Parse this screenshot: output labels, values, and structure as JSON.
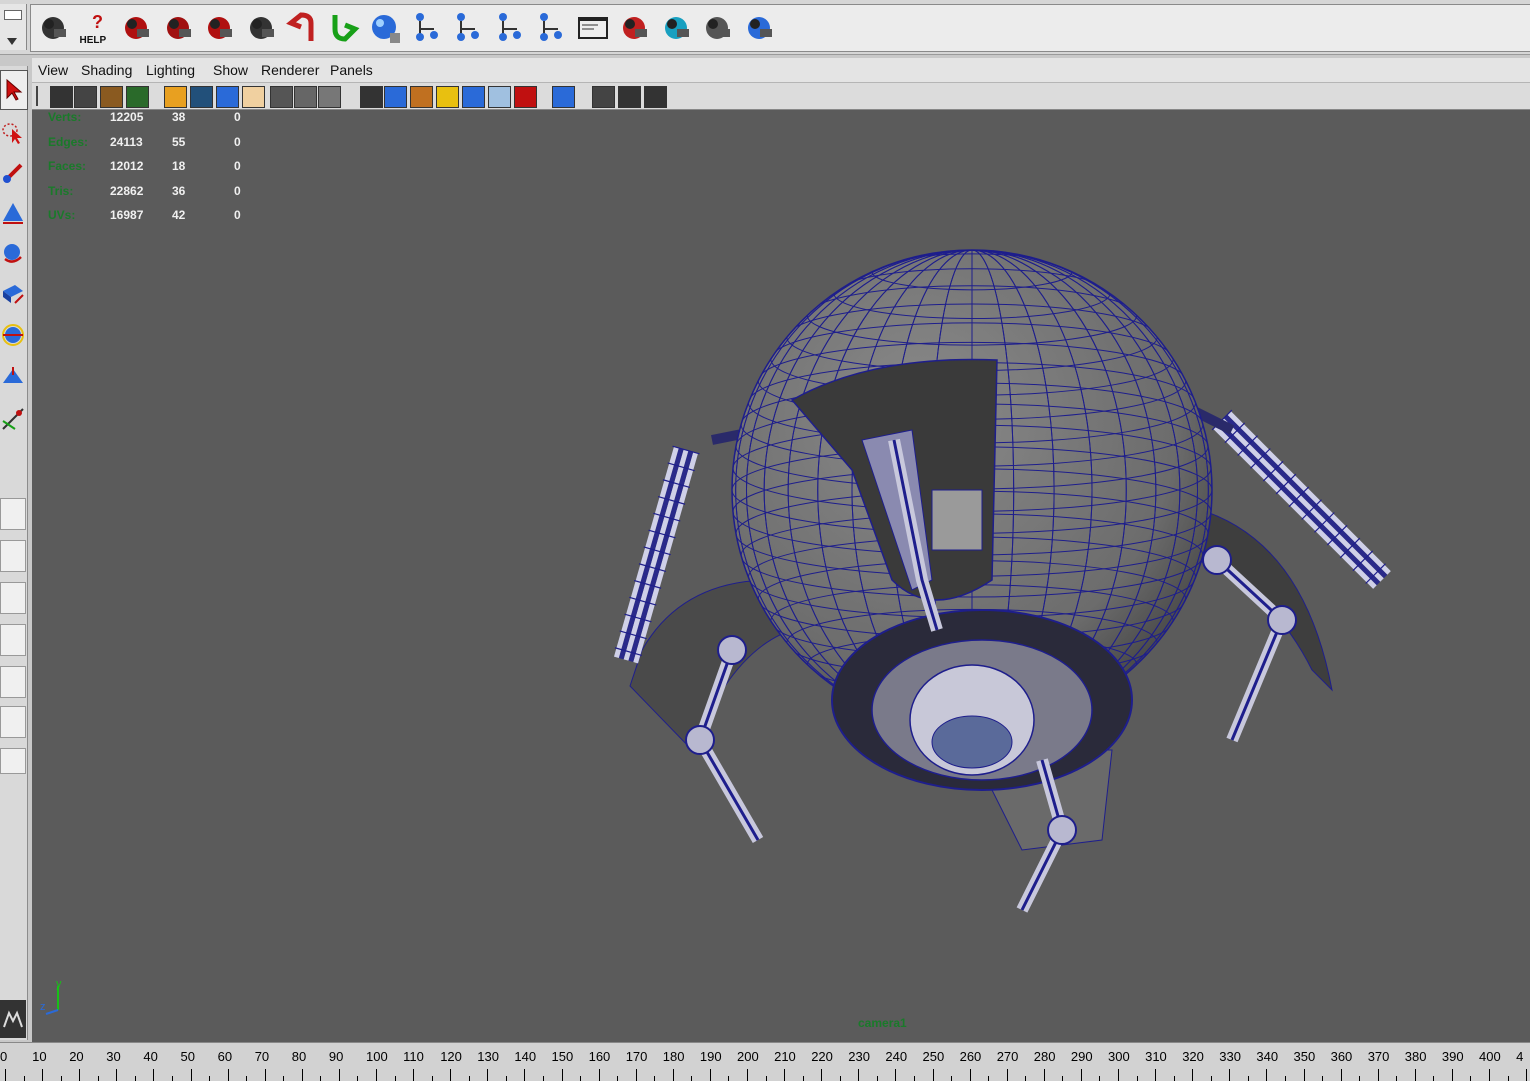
{
  "shelf": {
    "icons": [
      {
        "name": "camera-search-icon"
      },
      {
        "name": "help-icon",
        "label": "HELP"
      },
      {
        "name": "render-camera-icon"
      },
      {
        "name": "render-region-icon"
      },
      {
        "name": "ipr-render-icon"
      },
      {
        "name": "render-settings-icon"
      },
      {
        "name": "undo-red-icon"
      },
      {
        "name": "redo-green-icon"
      },
      {
        "name": "sphere-globe-icon"
      },
      {
        "name": "hierarchy-a-icon"
      },
      {
        "name": "hierarchy-b-icon"
      },
      {
        "name": "hierarchy-c-icon"
      },
      {
        "name": "hierarchy-d-icon"
      },
      {
        "name": "script-editor-icon"
      },
      {
        "name": "tool-settings-icon"
      },
      {
        "name": "hypershade-icon"
      },
      {
        "name": "box-render-icon"
      },
      {
        "name": "paint-icon"
      }
    ]
  },
  "panel": {
    "menus": [
      "View",
      "Shading",
      "Lighting",
      "Show",
      "Renderer",
      "Panels"
    ]
  },
  "hud": {
    "rows": [
      {
        "label": "Verts:",
        "v1": "12205",
        "v2": "38",
        "v3": "0"
      },
      {
        "label": "Edges:",
        "v1": "24113",
        "v2": "55",
        "v3": "0"
      },
      {
        "label": "Faces:",
        "v1": "12012",
        "v2": "18",
        "v3": "0"
      },
      {
        "label": "Tris:",
        "v1": "22862",
        "v2": "36",
        "v3": "0"
      },
      {
        "label": "UVs:",
        "v1": "16987",
        "v2": "42",
        "v3": "0"
      }
    ]
  },
  "viewport": {
    "camera": "camera1",
    "axis": {
      "y": "y",
      "z": "z"
    },
    "bg_color": "#5b5b5b",
    "wire_color": "#1e1e8c"
  },
  "timeslider": {
    "start": 0,
    "labels": [
      "0",
      "10",
      "20",
      "30",
      "40",
      "50",
      "60",
      "70",
      "80",
      "90",
      "100",
      "110",
      "120",
      "130",
      "140",
      "150",
      "160",
      "170",
      "180",
      "190",
      "200",
      "210",
      "220",
      "230",
      "240",
      "250",
      "260",
      "270",
      "280",
      "290",
      "300",
      "310",
      "320",
      "330",
      "340",
      "350",
      "360",
      "370",
      "380",
      "390",
      "400",
      "4"
    ]
  }
}
